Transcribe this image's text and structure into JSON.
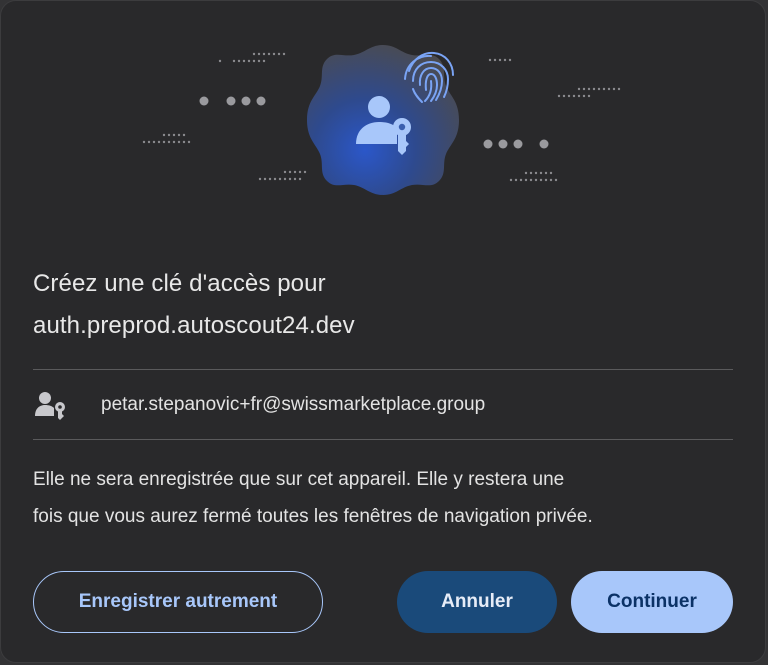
{
  "dialog": {
    "title_line1": "Créez une clé d'accès pour",
    "title_line2": "auth.preprod.autoscout24.dev",
    "account": {
      "icon": "person-key-icon",
      "email": "petar.stepanovic+fr@swissmarketplace.group"
    },
    "description_line1": "Elle ne sera enregistrée que sur cet appareil. Elle y restera une",
    "description_line2": "fois que vous aurez fermé toutes les fenêtres de navigation privée.",
    "buttons": {
      "other": "Enregistrer autrement",
      "cancel": "Annuler",
      "continue": "Continuer"
    }
  },
  "illustration": {
    "badge_icon": "person-key-icon",
    "corner_icon": "fingerprint-icon",
    "accent_color": "#a8c7fa",
    "badge_gradient": [
      "#2a4aa0",
      "#4a4a4e"
    ]
  }
}
